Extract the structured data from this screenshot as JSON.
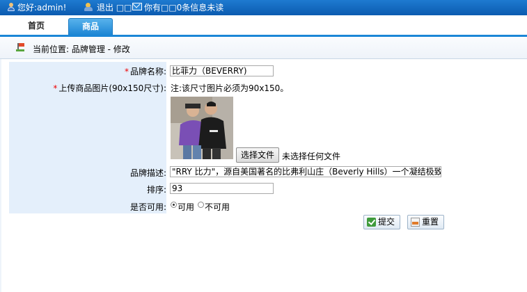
{
  "topbar": {
    "greeting": "您好:admin!",
    "logout": "退出 □□",
    "messages": "你有□□0条信息未读",
    "icons": [
      "user-icon",
      "logout-icon",
      "mail-icon"
    ]
  },
  "tabs": [
    {
      "label": "首页",
      "active": false
    },
    {
      "label": "商品",
      "active": true
    }
  ],
  "breadcrumb": {
    "text": "当前位置: 品牌管理 - 修改",
    "icon": "flag-icon"
  },
  "form": {
    "brand_name": {
      "label": "品牌名称:",
      "value": "比菲力（BEVERRY)",
      "required": true
    },
    "image": {
      "label": "上传商品图片(90x150尺寸):",
      "required": true,
      "note": "注:该尺寸图片必须为90x150。",
      "file_button": "选择文件",
      "file_status": "未选择任何文件"
    },
    "description": {
      "label": "品牌描述:",
      "value": "\"RRY 比力\"，源自美国著名的比弗利山庄（Beverly Hills）一个凝结极致奢"
    },
    "sort": {
      "label": "排序:",
      "value": "93"
    },
    "enabled": {
      "label": "是否可用:",
      "options": [
        {
          "label": "可用",
          "checked": true
        },
        {
          "label": "不可用",
          "checked": false
        }
      ]
    },
    "buttons": {
      "submit": "提交",
      "reset": "重置"
    }
  },
  "colors": {
    "topbar": "#0b5bb0",
    "tab_active": "#1d86d4",
    "form_label_bg": "#e4effb",
    "required": "#e00000"
  }
}
